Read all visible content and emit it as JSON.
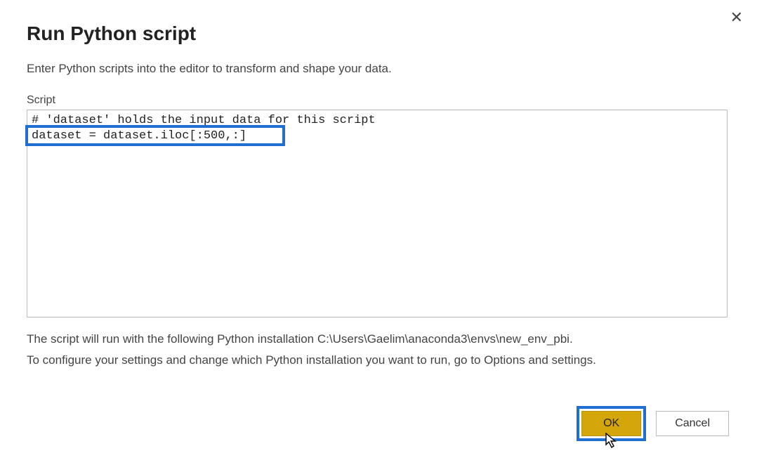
{
  "dialog": {
    "title": "Run Python script",
    "subtitle": "Enter Python scripts into the editor to transform and shape your data.",
    "script_label": "Script",
    "script_value": "# 'dataset' holds the input data for this script\ndataset = dataset.iloc[:500,:]",
    "install_line": "The script will run with the following Python installation C:\\Users\\Gaelim\\anaconda3\\envs\\new_env_pbi.",
    "config_line": "To configure your settings and change which Python installation you want to run, go to Options and settings.",
    "ok_label": "OK",
    "cancel_label": "Cancel",
    "close_icon": "✕"
  }
}
